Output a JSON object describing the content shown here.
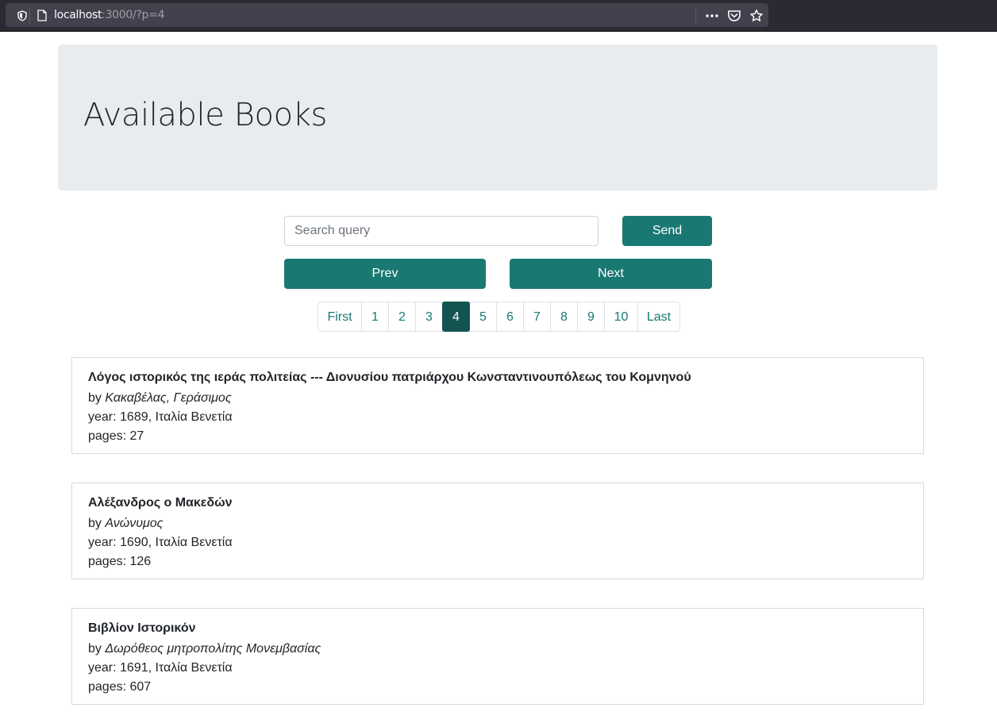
{
  "browser": {
    "url_host": "localhost",
    "url_path": ":3000/?p=4"
  },
  "page": {
    "title": "Available Books"
  },
  "search": {
    "placeholder": "Search query",
    "send_label": "Send"
  },
  "nav": {
    "prev_label": "Prev",
    "next_label": "Next"
  },
  "pagination": {
    "items": [
      "First",
      "1",
      "2",
      "3",
      "4",
      "5",
      "6",
      "7",
      "8",
      "9",
      "10",
      "Last"
    ],
    "active": "4"
  },
  "books": [
    {
      "title": "Λόγος ιστορικός της ιεράς πολιτείας --- Διονυσίου πατριάρχου Κωνσταντινουπόλεως του Κομνηνού",
      "by_label": "by",
      "author": "Κακαβέλας, Γεράσιμος",
      "year_line": "year: 1689, Ιταλία Βενετία",
      "pages_line": "pages: 27"
    },
    {
      "title": "Αλέξανδρος ο Μακεδών",
      "by_label": "by",
      "author": "Ανώνυμος",
      "year_line": "year: 1690, Ιταλία Βενετία",
      "pages_line": "pages: 126"
    },
    {
      "title": "Βιβλίον Ιστορικόν",
      "by_label": "by",
      "author": "Δωρόθεος μητροπολίτης Μονεμβασίας",
      "year_line": "year: 1691, Ιταλία Βενετία",
      "pages_line": "pages: 607"
    }
  ],
  "colors": {
    "accent": "#1a7872",
    "active": "#145450",
    "jumbotron_bg": "#e9ecef"
  }
}
